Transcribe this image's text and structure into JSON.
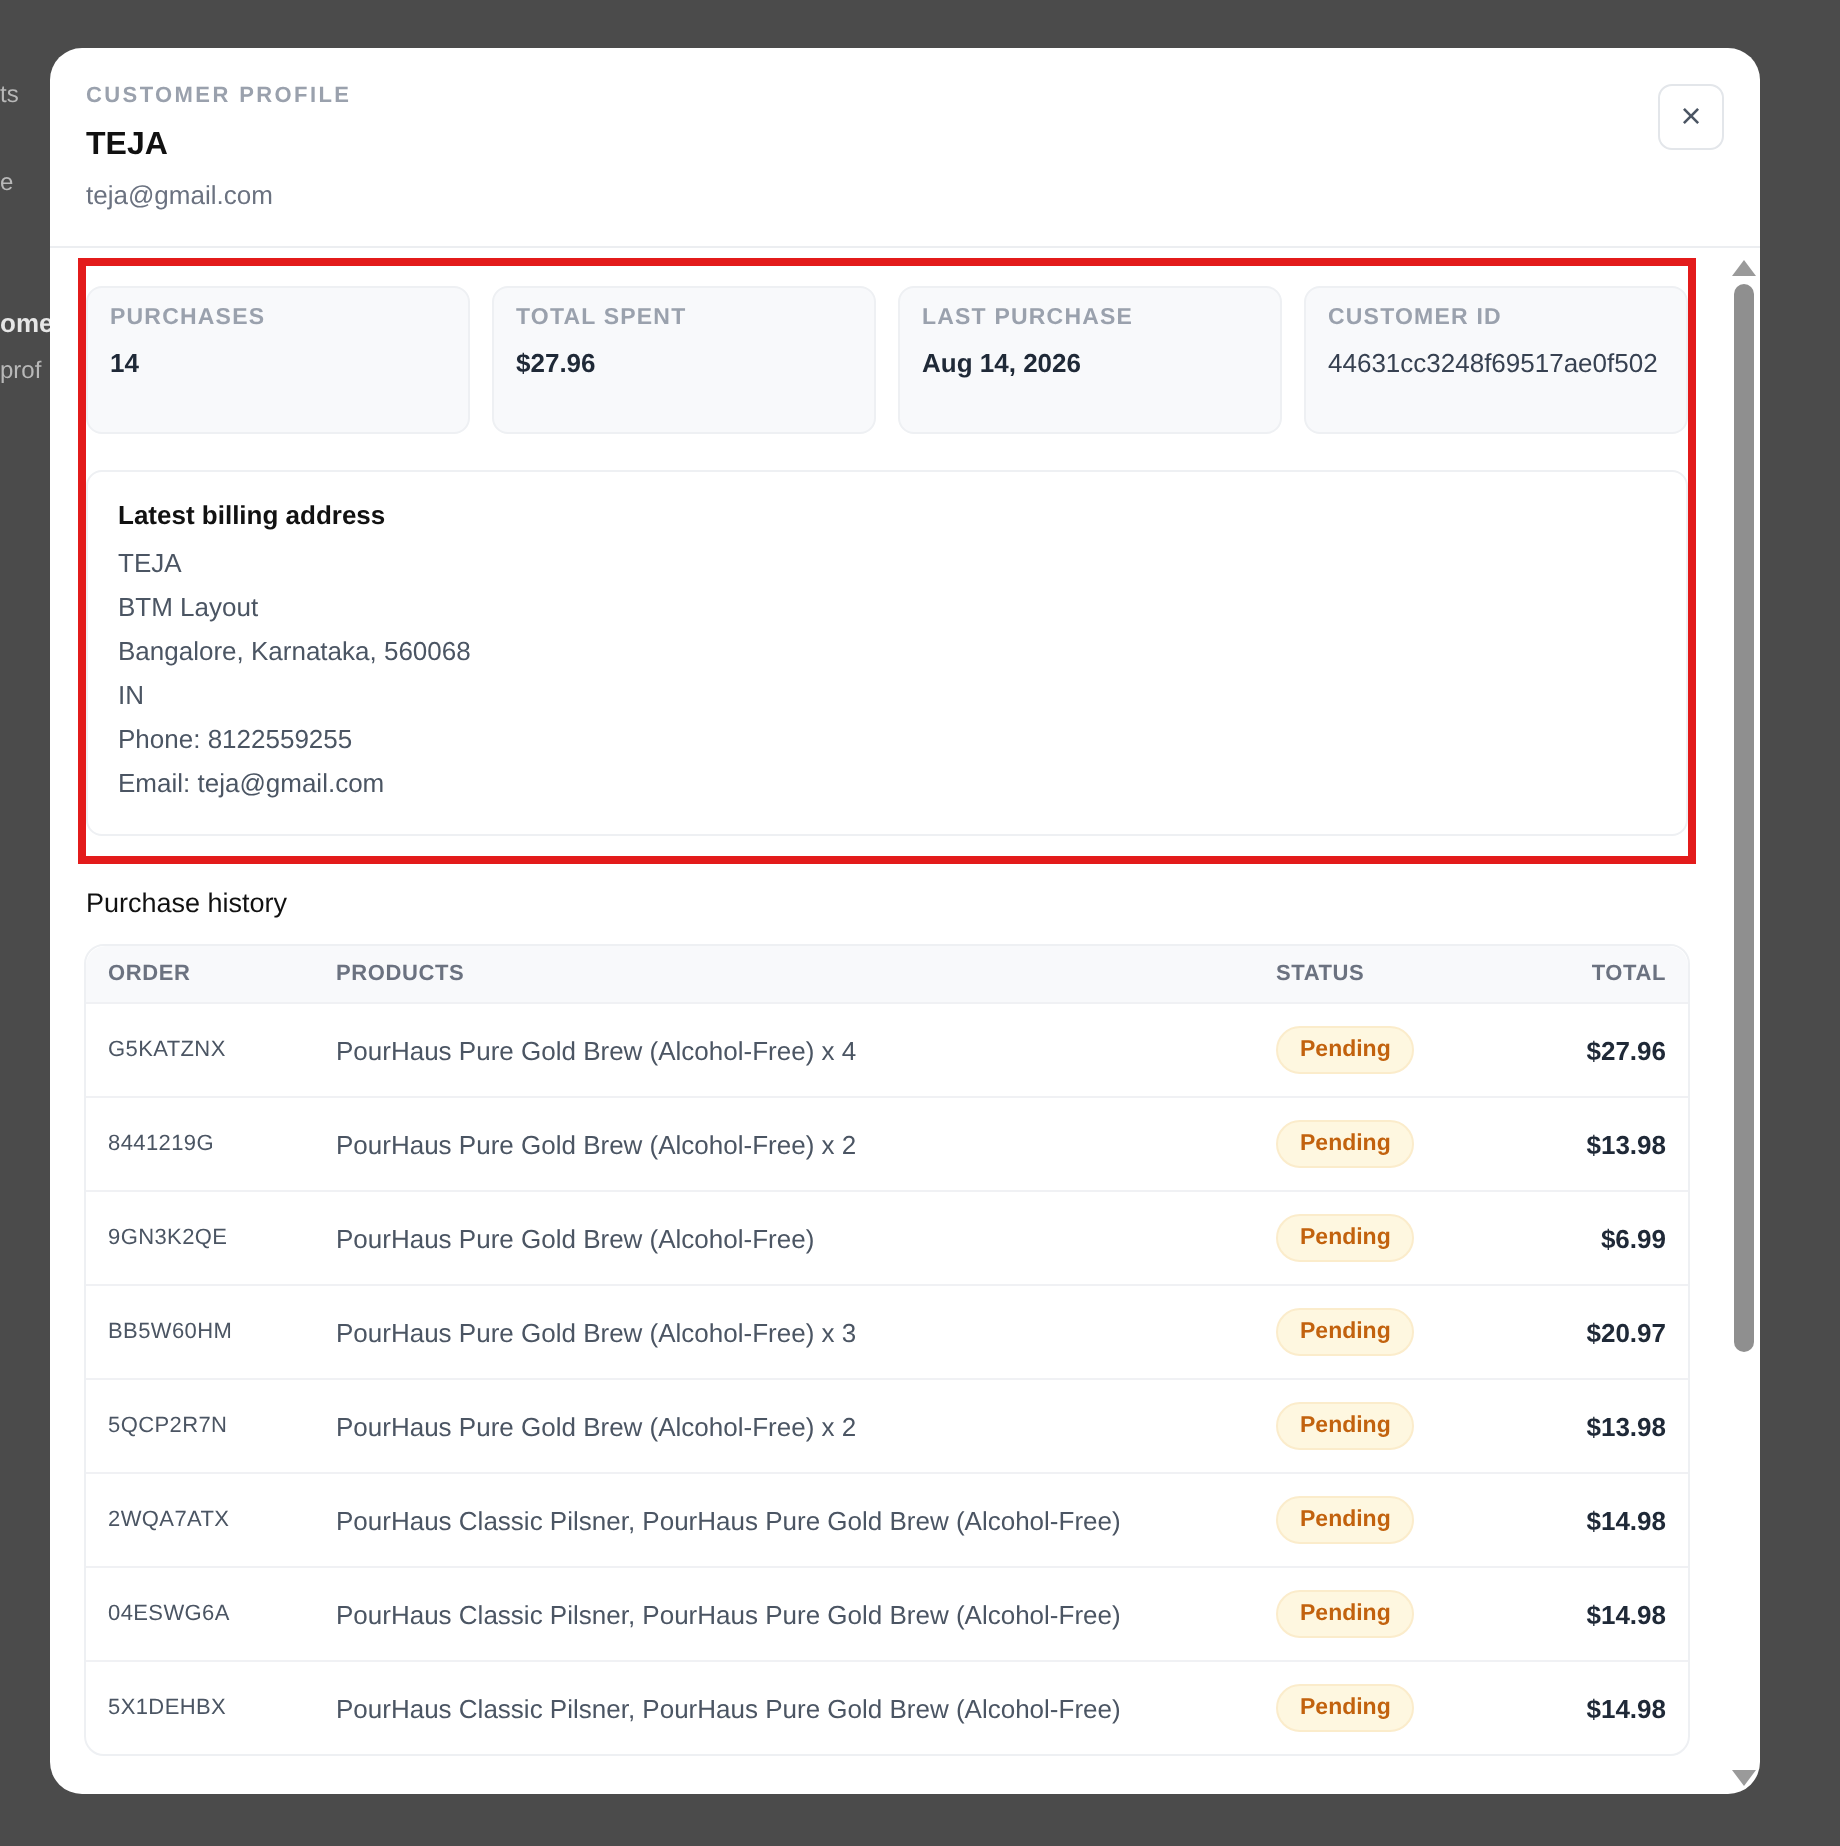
{
  "background": {
    "fragments": [
      {
        "text": "ts",
        "kind": "nav"
      },
      {
        "text": "e",
        "kind": "nav"
      },
      {
        "text": "ome",
        "kind": "heading"
      },
      {
        "text": "prof",
        "kind": "subtext"
      }
    ]
  },
  "modal": {
    "eyebrow": "CUSTOMER PROFILE",
    "name": "TEJA",
    "email": "teja@gmail.com",
    "close": "×"
  },
  "stats": [
    {
      "label": "PURCHASES",
      "value": "14"
    },
    {
      "label": "TOTAL SPENT",
      "value": "$27.96"
    },
    {
      "label": "LAST PURCHASE",
      "value": "Aug 14, 2026"
    },
    {
      "label": "CUSTOMER ID",
      "value": "44631cc3248f69517ae0f502"
    }
  ],
  "billing": {
    "title": "Latest billing address",
    "lines": [
      "TEJA",
      "BTM Layout",
      "Bangalore, Karnataka, 560068",
      "IN",
      "Phone: 8122559255",
      "Email: teja@gmail.com"
    ]
  },
  "purchase_history": {
    "title": "Purchase history",
    "columns": [
      "ORDER",
      "PRODUCTS",
      "STATUS",
      "TOTAL"
    ],
    "rows": [
      {
        "order": "G5KATZNX",
        "products": "PourHaus Pure Gold Brew (Alcohol-Free) x 4",
        "status": {
          "label": "Pending",
          "kind": "pending"
        },
        "total": "$27.96"
      },
      {
        "order": "8441219G",
        "products": "PourHaus Pure Gold Brew (Alcohol-Free) x 2",
        "status": {
          "label": "Pending",
          "kind": "pending"
        },
        "total": "$13.98"
      },
      {
        "order": "9GN3K2QE",
        "products": "PourHaus Pure Gold Brew (Alcohol-Free)",
        "status": {
          "label": "Pending",
          "kind": "pending"
        },
        "total": "$6.99"
      },
      {
        "order": "BB5W60HM",
        "products": "PourHaus Pure Gold Brew (Alcohol-Free) x 3",
        "status": {
          "label": "Pending",
          "kind": "pending"
        },
        "total": "$20.97"
      },
      {
        "order": "5QCP2R7N",
        "products": "PourHaus Pure Gold Brew (Alcohol-Free) x 2",
        "status": {
          "label": "Pending",
          "kind": "pending"
        },
        "total": "$13.98"
      },
      {
        "order": "2WQA7ATX",
        "products": "PourHaus Classic Pilsner, PourHaus Pure Gold Brew (Alcohol-Free)",
        "status": {
          "label": "Pending",
          "kind": "pending"
        },
        "total": "$14.98"
      },
      {
        "order": "04ESWG6A",
        "products": "PourHaus Classic Pilsner, PourHaus Pure Gold Brew (Alcohol-Free)",
        "status": {
          "label": "Pending",
          "kind": "pending"
        },
        "total": "$14.98"
      },
      {
        "order": "5X1DEHBX",
        "products": "PourHaus Classic Pilsner, PourHaus Pure Gold Brew (Alcohol-Free)",
        "status": {
          "label": "Pending",
          "kind": "pending"
        },
        "total": "$14.98"
      }
    ]
  }
}
